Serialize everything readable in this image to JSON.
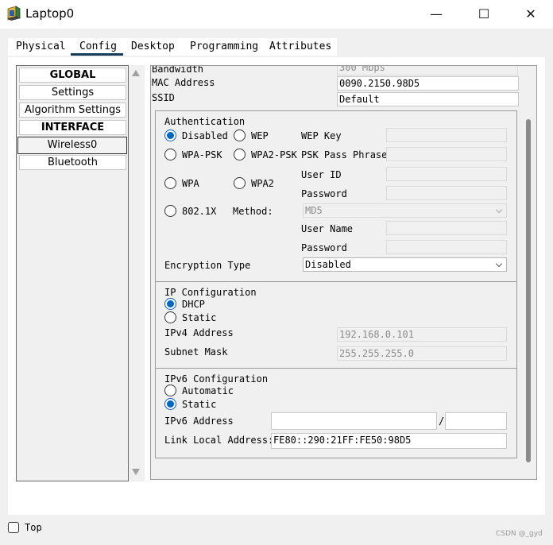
{
  "window": {
    "title": "Laptop0",
    "minimize_glyph": "—",
    "maximize_glyph": "☐",
    "close_glyph": "✕"
  },
  "tabs": [
    "Physical",
    "Config",
    "Desktop",
    "Programming",
    "Attributes"
  ],
  "active_tab": "Config",
  "sidebar": {
    "items": [
      {
        "label": "GLOBAL",
        "header": true
      },
      {
        "label": "Settings"
      },
      {
        "label": "Algorithm Settings"
      },
      {
        "label": "INTERFACE",
        "header": true
      },
      {
        "label": "Wireless0",
        "selected": true
      },
      {
        "label": "Bluetooth"
      }
    ]
  },
  "wireless": {
    "bandwidth_label": "Bandwidth",
    "bandwidth_value": "300 Mbps",
    "mac_label": "MAC Address",
    "mac_value": "0090.2150.98D5",
    "ssid_label": "SSID",
    "ssid_value": "Default"
  },
  "auth": {
    "title": "Authentication",
    "options": {
      "disabled": "Disabled",
      "wep": "WEP",
      "wpa_psk": "WPA-PSK",
      "wpa2_psk": "WPA2-PSK",
      "wpa": "WPA",
      "wpa2": "WPA2",
      "x8021": "802.1X"
    },
    "selected": "Disabled",
    "wep_key_label": "WEP Key",
    "psk_label": "PSK Pass Phrase",
    "user_id_label": "User ID",
    "password_label": "Password",
    "method_label": "Method:",
    "method_value": "MD5",
    "user_name_label": "User Name",
    "password2_label": "Password",
    "encryption_label": "Encryption Type",
    "encryption_value": "Disabled"
  },
  "ip": {
    "title": "IP Configuration",
    "dhcp": "DHCP",
    "static": "Static",
    "selected": "DHCP",
    "ipv4_label": "IPv4 Address",
    "ipv4_value": "192.168.0.101",
    "mask_label": "Subnet Mask",
    "mask_value": "255.255.255.0"
  },
  "ipv6": {
    "title": "IPv6 Configuration",
    "automatic": "Automatic",
    "static": "Static",
    "selected": "Static",
    "address_label": "IPv6 Address",
    "address_value": "",
    "prefix_sep": "/",
    "prefix_value": "",
    "link_local_label": "Link Local Address:",
    "link_local_value": "FE80::290:21FF:FE50:98D5"
  },
  "footer": {
    "top_label": "Top",
    "watermark": "CSDN @_gyd"
  }
}
